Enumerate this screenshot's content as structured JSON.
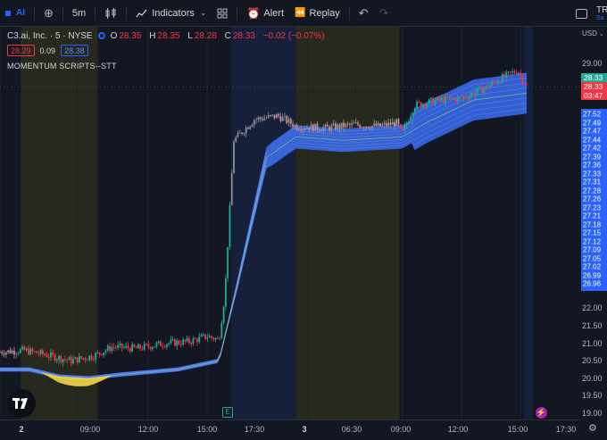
{
  "toolbar": {
    "symbol": "AI",
    "interval": "5m",
    "indicators_label": "Indicators",
    "alert_label": "Alert",
    "replay_label": "Replay",
    "right_clipped": "TRE",
    "right_clipped_sub": "Sa"
  },
  "legend": {
    "title": "C3.ai, Inc. · 5 · NYSE",
    "open_key": "O",
    "open": "28.35",
    "high_key": "H",
    "high": "28.35",
    "low_key": "L",
    "low": "28.28",
    "close_key": "C",
    "close": "28.33",
    "change": "−0.02 (−0.07%)",
    "bid": "28.29",
    "spread": "0.09",
    "ask": "28.38",
    "indicator_name": "MOMENTUM SCRIPTS--STT"
  },
  "price_axis": {
    "currency": "USD",
    "labels": [
      {
        "text": "29.00",
        "value": 29.0
      },
      {
        "text": "22.00",
        "value": 22.0
      },
      {
        "text": "21.50",
        "value": 21.5
      },
      {
        "text": "21.00",
        "value": 21.0
      },
      {
        "text": "20.50",
        "value": 20.5
      },
      {
        "text": "20.00",
        "value": 20.0
      },
      {
        "text": "19.50",
        "value": 19.5
      },
      {
        "text": "19.00",
        "value": 19.0
      }
    ],
    "band_labels": [
      "27.52",
      "27.49",
      "27.47",
      "27.44",
      "27.42",
      "27.39",
      "27.36",
      "27.33",
      "27.31",
      "27.28",
      "27.26",
      "27.23",
      "27.21",
      "27.18",
      "27.15",
      "27.12",
      "27.09",
      "27.05",
      "27.02",
      "26.99",
      "26.96"
    ],
    "band_label_first": "27.52",
    "tag_last_price": "28.33",
    "tag_close": "28.33",
    "tag_countdown": "03:47"
  },
  "time_axis": {
    "labels": [
      {
        "text": "2",
        "bold": true
      },
      {
        "text": "09:00"
      },
      {
        "text": "12:00"
      },
      {
        "text": "15:00"
      },
      {
        "text": "17:30"
      },
      {
        "text": "3",
        "bold": true
      },
      {
        "text": "06:30"
      },
      {
        "text": "09:00"
      },
      {
        "text": "12:00"
      },
      {
        "text": "15:00"
      },
      {
        "text": "17:30"
      }
    ]
  },
  "markers": {
    "earnings": "E",
    "bolt": "⚡"
  },
  "colors": {
    "background": "#131722",
    "up": "#22ab94",
    "down": "#f23645",
    "ribbon": "#2962ff",
    "ribbon_fill": "#3b6cf0",
    "ribbon_low": "#f5d547",
    "premarket_session": "#2a2a1e",
    "postmarket_session": "#16213d"
  },
  "chart_data": {
    "type": "candlestick",
    "ylim": [
      19.0,
      29.2
    ],
    "session_shading": [
      {
        "kind": "premarket",
        "from": 0.035,
        "to": 0.165
      },
      {
        "kind": "postmarket",
        "from": 0.39,
        "to": 0.5
      },
      {
        "kind": "premarket",
        "from": 0.5,
        "to": 0.675
      },
      {
        "kind": "postmarket",
        "from": 0.885,
        "to": 0.9
      }
    ],
    "price_path": [
      {
        "t": 0.0,
        "p": 20.75
      },
      {
        "t": 0.04,
        "p": 20.8
      },
      {
        "t": 0.07,
        "p": 20.7
      },
      {
        "t": 0.12,
        "p": 20.5
      },
      {
        "t": 0.16,
        "p": 20.65
      },
      {
        "t": 0.19,
        "p": 20.9
      },
      {
        "t": 0.23,
        "p": 20.85
      },
      {
        "t": 0.28,
        "p": 21.0
      },
      {
        "t": 0.32,
        "p": 21.05
      },
      {
        "t": 0.35,
        "p": 21.2
      },
      {
        "t": 0.37,
        "p": 21.1
      },
      {
        "t": 0.38,
        "p": 22.4
      },
      {
        "t": 0.395,
        "p": 26.8
      },
      {
        "t": 0.43,
        "p": 27.4
      },
      {
        "t": 0.47,
        "p": 27.5
      },
      {
        "t": 0.5,
        "p": 27.2
      },
      {
        "t": 0.55,
        "p": 27.15
      },
      {
        "t": 0.6,
        "p": 27.25
      },
      {
        "t": 0.64,
        "p": 27.2
      },
      {
        "t": 0.67,
        "p": 27.3
      },
      {
        "t": 0.68,
        "p": 27.0
      },
      {
        "t": 0.7,
        "p": 27.8
      },
      {
        "t": 0.74,
        "p": 27.95
      },
      {
        "t": 0.78,
        "p": 28.0
      },
      {
        "t": 0.82,
        "p": 28.3
      },
      {
        "t": 0.85,
        "p": 28.6
      },
      {
        "t": 0.875,
        "p": 28.8
      },
      {
        "t": 0.89,
        "p": 28.33
      }
    ],
    "ribbon_path": [
      {
        "t": 0.0,
        "p": 20.25
      },
      {
        "t": 0.05,
        "p": 20.25
      },
      {
        "t": 0.1,
        "p": 20.05
      },
      {
        "t": 0.15,
        "p": 20.0
      },
      {
        "t": 0.2,
        "p": 20.1
      },
      {
        "t": 0.3,
        "p": 20.25
      },
      {
        "t": 0.37,
        "p": 20.5
      },
      {
        "t": 0.4,
        "p": 22.6
      },
      {
        "t": 0.45,
        "p": 26.3
      },
      {
        "t": 0.5,
        "p": 26.9
      },
      {
        "t": 0.58,
        "p": 26.8
      },
      {
        "t": 0.68,
        "p": 26.9
      },
      {
        "t": 0.72,
        "p": 27.3
      },
      {
        "t": 0.8,
        "p": 27.95
      },
      {
        "t": 0.89,
        "p": 28.15
      }
    ]
  }
}
